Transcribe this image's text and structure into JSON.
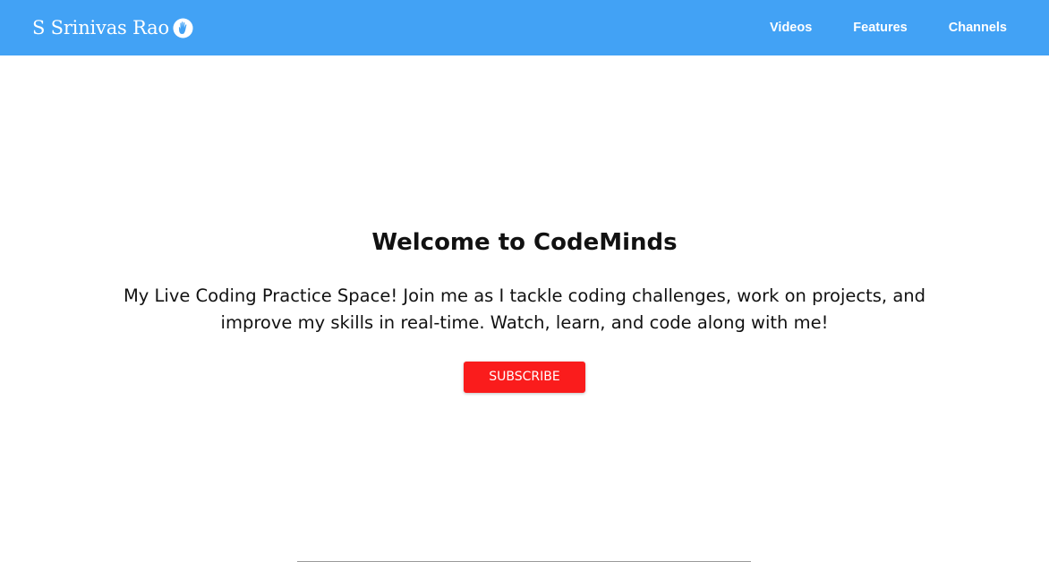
{
  "colors": {
    "navbar_bg": "#42a2f5",
    "nav_text": "#ffffff",
    "heading_text": "#111111",
    "subscribe_bg": "#fa1c1c",
    "divider": "#9a9a9a"
  },
  "navbar": {
    "brand_name": "S Srinivas Rao",
    "brand_icon": "hand-icon",
    "links": [
      {
        "label": "Videos"
      },
      {
        "label": "Features"
      },
      {
        "label": "Channels"
      }
    ]
  },
  "hero": {
    "title": "Welcome to CodeMinds",
    "description": "My Live Coding Practice Space! Join me as I tackle coding challenges, work on projects, and improve my skills in real-time. Watch, learn, and code along with me!",
    "subscribe_label": "SUBSCRIBE"
  }
}
